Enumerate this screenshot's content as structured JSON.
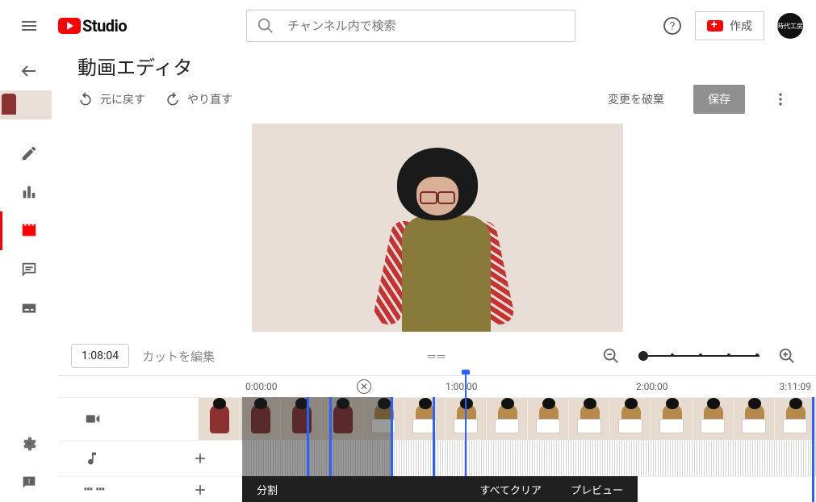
{
  "brand": "Studio",
  "search": {
    "placeholder": "チャンネル内で検索"
  },
  "create_label": "作成",
  "avatar_label": "時代工房",
  "page_title": "動画エディタ",
  "toolbar": {
    "undo": "元に戻す",
    "redo": "やり直す",
    "discard": "変更を破棄",
    "save": "保存"
  },
  "controls": {
    "time_position": "1:08:04",
    "edit_cut_label": "カットを編集"
  },
  "ruler": {
    "start": "0:00:00",
    "one_hour": "1:00:00",
    "two_hour": "2:00:00",
    "end": "3:11:09"
  },
  "bottom": {
    "split": "分割",
    "clear_all": "すべてクリア",
    "preview": "プレビュー"
  },
  "icons": {
    "menu": "menu",
    "search": "search",
    "help": "help",
    "back": "back",
    "pencil": "edit",
    "analytics": "analytics",
    "editor": "editor",
    "comments": "comments",
    "subtitles": "subtitles",
    "settings": "settings",
    "feedback": "feedback",
    "undo": "undo",
    "redo": "redo",
    "more": "more",
    "zoom_out": "zoom-out",
    "zoom_in": "zoom-in",
    "camera": "camera",
    "music": "music",
    "plus": "plus",
    "close": "close"
  }
}
